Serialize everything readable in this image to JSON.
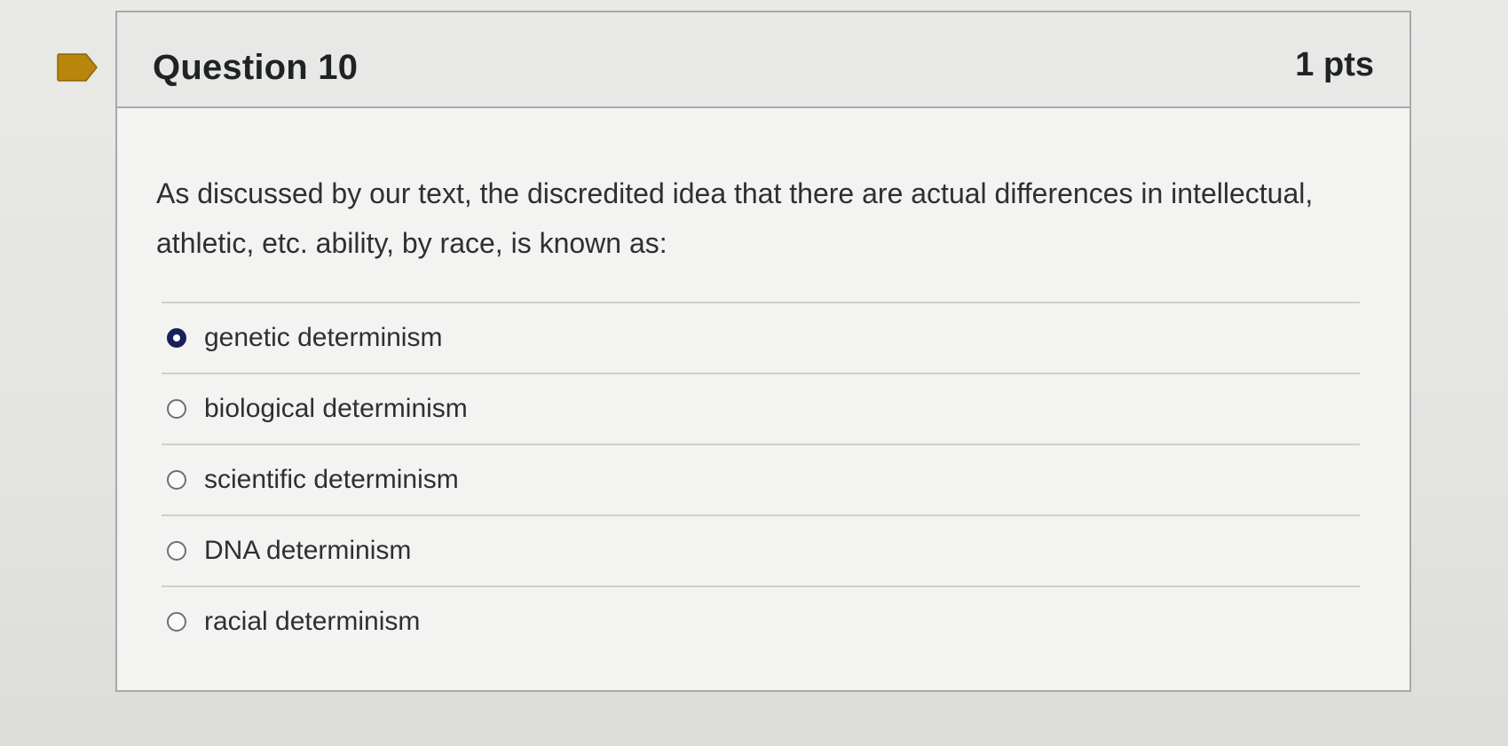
{
  "question": {
    "title": "Question 10",
    "points": "1 pts",
    "text": "As discussed by our text, the discredited idea that there are actual differences in intellectual, athletic, etc. ability, by race, is known as:",
    "flag_color": "#b8860b"
  },
  "answers": [
    {
      "label": "genetic determinism",
      "selected": true
    },
    {
      "label": "biological determinism",
      "selected": false
    },
    {
      "label": "scientific determinism",
      "selected": false
    },
    {
      "label": "DNA determinism",
      "selected": false
    },
    {
      "label": "racial determinism",
      "selected": false
    }
  ]
}
